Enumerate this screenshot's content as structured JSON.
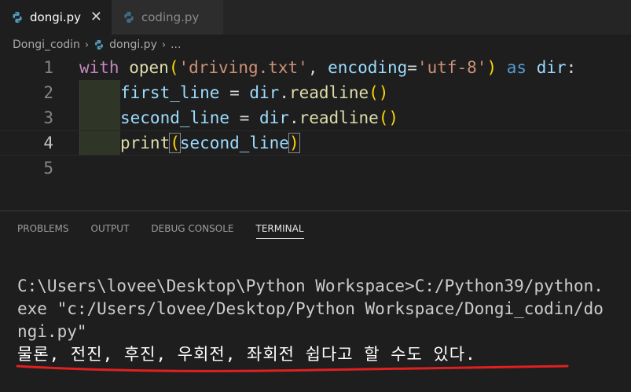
{
  "tabs": [
    {
      "label": "dongi.py",
      "active": true,
      "close_glyph": "✕"
    },
    {
      "label": "coding.py",
      "active": false
    }
  ],
  "breadcrumb": {
    "folder": "Dongi_codin",
    "file": "dongi.py",
    "more": "...",
    "separator": "›"
  },
  "editor": {
    "line_numbers": [
      "1",
      "2",
      "3",
      "4",
      "5"
    ],
    "current_line": "4",
    "code": {
      "l1": {
        "with": "with",
        "open": "open",
        "lp": "(",
        "str1": "'driving.txt'",
        "comma": ", ",
        "enc": "encoding",
        "eq": "=",
        "str2": "'utf-8'",
        "rp": ")",
        "as": "as",
        "dir": "dir",
        "colon": ":"
      },
      "l2": {
        "var": "first_line",
        "eq": " = ",
        "obj": "dir",
        "dot": ".",
        "fn": "readline",
        "lp": "(",
        "rp": ")"
      },
      "l3": {
        "var": "second_line",
        "eq": " = ",
        "obj": "dir",
        "dot": ".",
        "fn": "readline",
        "lp": "(",
        "rp": ")"
      },
      "l4": {
        "fn": "print",
        "lp": "(",
        "arg": "second_line",
        "rp": ")"
      }
    }
  },
  "panel": {
    "tabs": [
      "PROBLEMS",
      "OUTPUT",
      "DEBUG CONSOLE",
      "TERMINAL"
    ],
    "active_tab": "TERMINAL"
  },
  "terminal": {
    "lines": [
      "C:\\Users\\lovee\\Desktop\\Python Workspace>C:/Python39/python.",
      "exe \"c:/Users/lovee/Desktop/Python Workspace/Dongi_codin/do",
      "ngi.py\"",
      "물론, 전진, 후진, 우회전, 좌회전 쉽다고 할 수도 있다."
    ]
  },
  "colors": {
    "background": "#1e1e1e",
    "tabbar": "#252526",
    "underline_annotation": "#e02020"
  }
}
